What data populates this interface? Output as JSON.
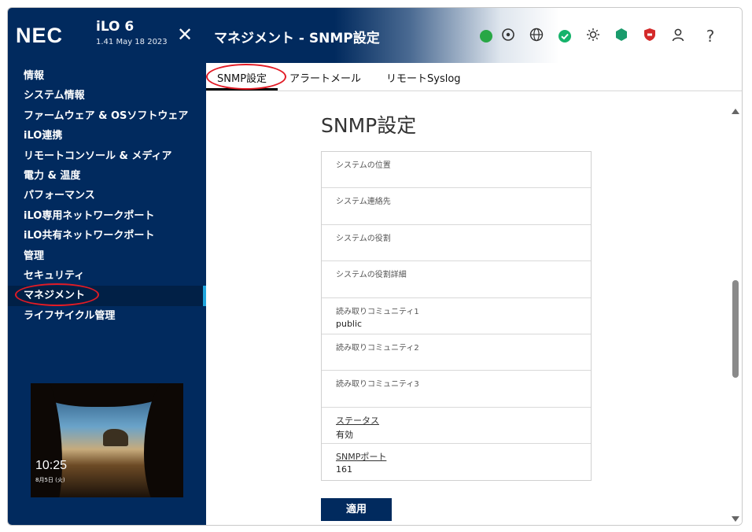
{
  "brand": {
    "logo": "NEC",
    "product": "iLO 6",
    "version": "1.41 May 18 2023"
  },
  "header": {
    "title": "マネジメント - SNMP設定"
  },
  "header_icons": [
    "power-icon",
    "location-icon",
    "globe-icon",
    "health-ok-icon",
    "uid-light-icon",
    "security-shield-icon",
    "security-alert-icon",
    "user-icon",
    "help-icon"
  ],
  "header_icon_glyphs": {
    "help": "?",
    "close": "✕"
  },
  "colors": {
    "sidebar": "#012a5e",
    "accent": "#1fa6de",
    "highlight_circle": "#e21b25",
    "ok_green": "#16b36b",
    "power_green": "#28a745"
  },
  "sidebar": {
    "items": [
      {
        "label": "情報"
      },
      {
        "label": "システム情報"
      },
      {
        "label": "ファームウェア & OSソフトウェア"
      },
      {
        "label": "iLO連携"
      },
      {
        "label": "リモートコンソール & メディア"
      },
      {
        "label": "電力 & 温度"
      },
      {
        "label": "パフォーマンス"
      },
      {
        "label": "iLO専用ネットワークポート"
      },
      {
        "label": "iLO共有ネットワークポート"
      },
      {
        "label": "管理"
      },
      {
        "label": "セキュリティ"
      },
      {
        "label": "マネジメント",
        "active": true
      },
      {
        "label": "ライフサイクル管理"
      }
    ]
  },
  "console_thumbnail": {
    "time": "10:25",
    "date": "8月5日 (火)"
  },
  "tabs": [
    {
      "label": "SNMP設定",
      "active": true
    },
    {
      "label": "アラートメール"
    },
    {
      "label": "リモートSyslog"
    }
  ],
  "main": {
    "title": "SNMP設定",
    "fields": [
      {
        "label": "システムの位置",
        "value": ""
      },
      {
        "label": "システム連絡先",
        "value": ""
      },
      {
        "label": "システムの役割",
        "value": ""
      },
      {
        "label": "システムの役割詳細",
        "value": ""
      },
      {
        "label": "読み取りコミュニティ1",
        "value": "public"
      },
      {
        "label": "読み取りコミュニティ2",
        "value": ""
      },
      {
        "label": "読み取りコミュニティ3",
        "value": ""
      },
      {
        "label": "ステータス",
        "value": "有効",
        "link": true
      },
      {
        "label": "SNMPポート",
        "value": "161",
        "link": true
      }
    ],
    "apply_label": "適用"
  }
}
